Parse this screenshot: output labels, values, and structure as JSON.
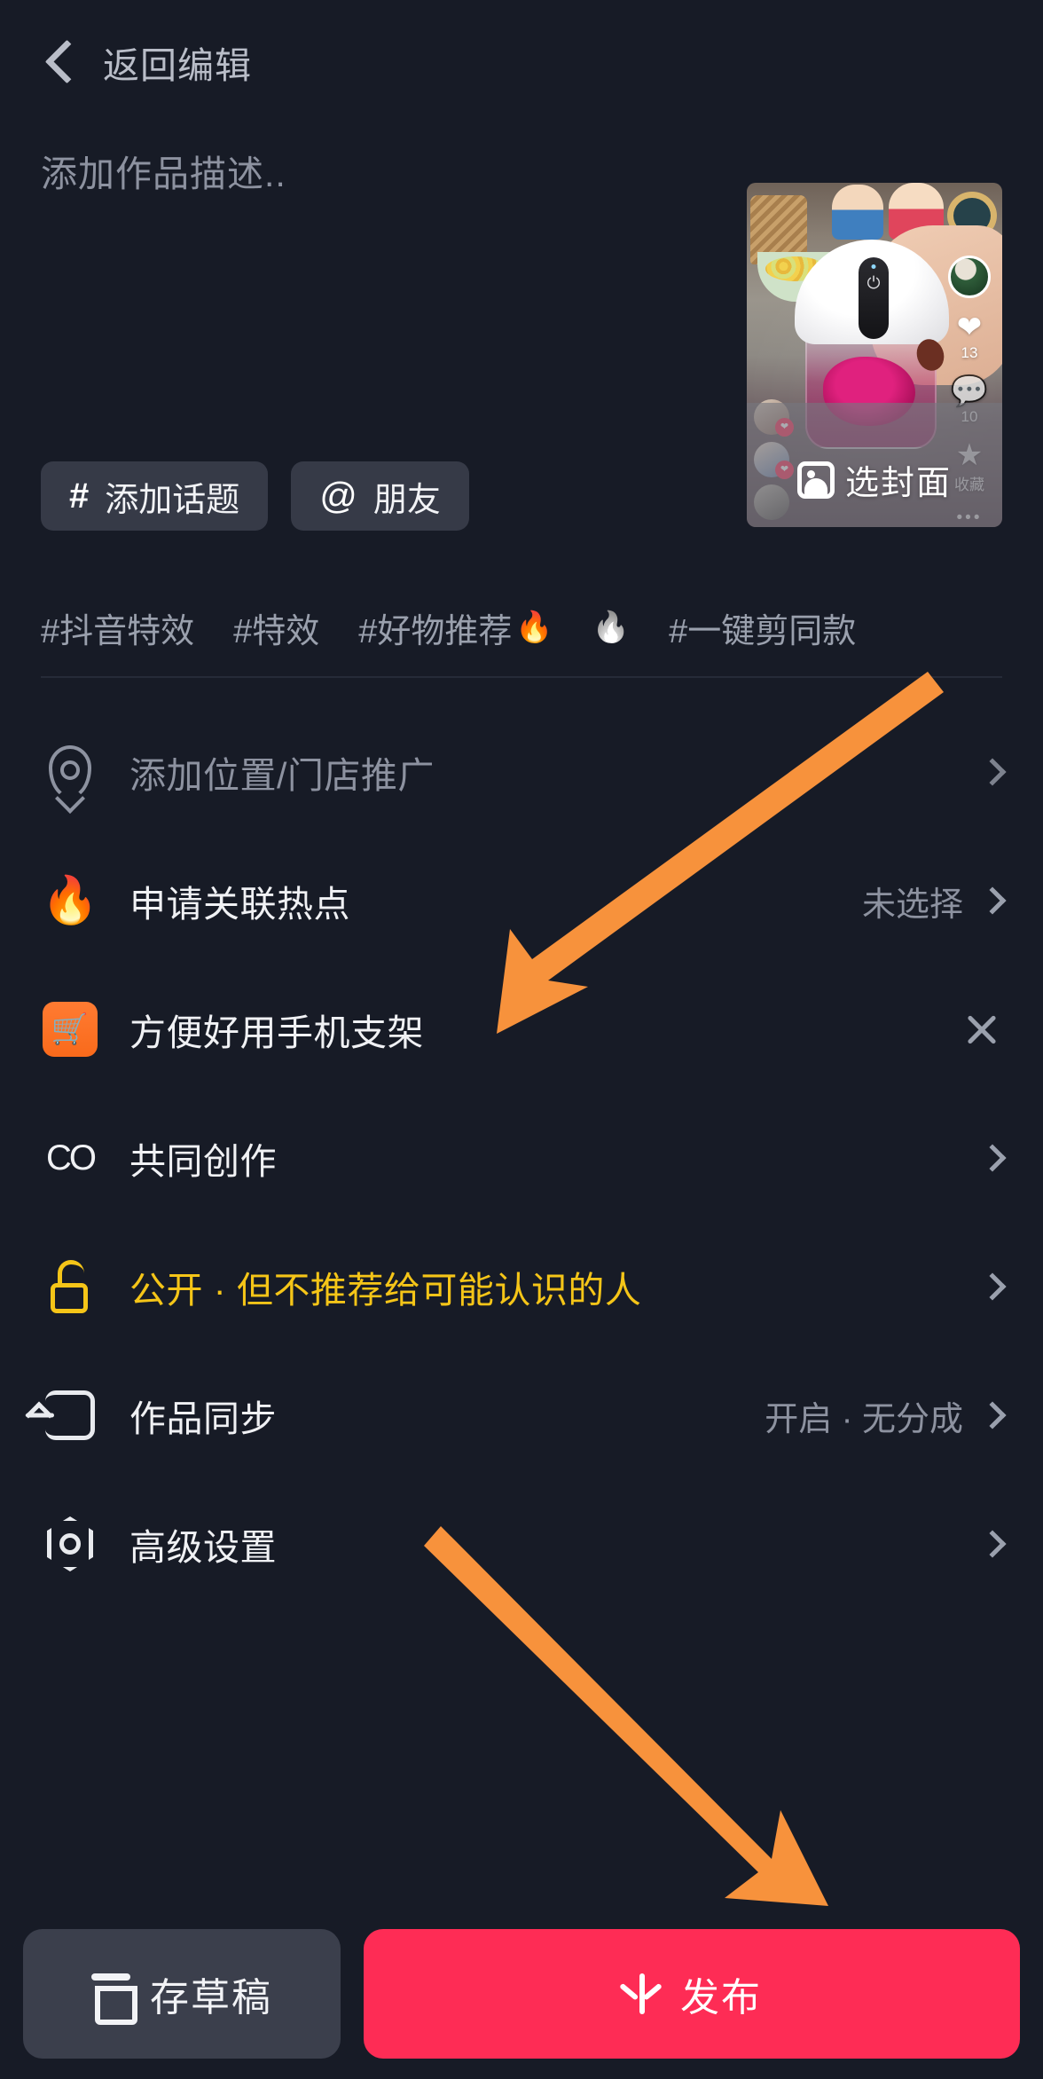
{
  "header": {
    "back_label": "返回编辑",
    "back_icon": "chevron-left-icon"
  },
  "description": {
    "placeholder": "添加作品描述..",
    "value": ""
  },
  "chips": [
    {
      "glyph": "#",
      "label": "添加话题",
      "name": "add-topic"
    },
    {
      "glyph": "@",
      "label": "朋友",
      "name": "mention-friend"
    }
  ],
  "hashtag_suggestions": [
    {
      "text": "#抖音特效",
      "emoji": ""
    },
    {
      "text": "#特效",
      "emoji": ""
    },
    {
      "text": "#好物推荐",
      "emoji": "🔥"
    },
    {
      "text": "",
      "emoji": "🔥",
      "gray": true
    },
    {
      "text": "#一键剪同款",
      "emoji": ""
    }
  ],
  "rows": {
    "location": {
      "icon": "location-pin-icon",
      "label": "添加位置/门店推广",
      "value": "",
      "chevron": "chevron-right-icon"
    },
    "hotspot": {
      "icon": "flame-icon",
      "icon_glyph": "🔥",
      "label": "申请关联热点",
      "value": "未选择",
      "chevron": "chevron-right-icon"
    },
    "product": {
      "icon": "shopping-cart-icon",
      "icon_glyph": "🛒",
      "label": "方便好用手机支架",
      "action": "close-icon"
    },
    "cocreate": {
      "icon": "co-create-icon",
      "icon_glyph": "CO",
      "label": "共同创作",
      "value": "",
      "chevron": "chevron-right-icon"
    },
    "privacy": {
      "icon": "unlock-icon",
      "label": "公开 · 但不推荐给可能认识的人",
      "value": "",
      "chevron": "chevron-right-icon",
      "color": "#f5c518"
    },
    "sync": {
      "icon": "sync-export-icon",
      "label": "作品同步",
      "value": "开启 · 无分成",
      "chevron": "chevron-right-icon"
    },
    "advanced": {
      "icon": "advanced-settings-icon",
      "label": "高级设置",
      "value": "",
      "chevron": "chevron-right-icon"
    }
  },
  "thumbnail": {
    "cover_cta": "选封面",
    "cover_icon": "image-icon",
    "rail": {
      "avatar": "author-avatar",
      "like_icon": "heart-icon",
      "like_count": "13",
      "comment_icon": "comment-bubble-icon",
      "comment_count": "10",
      "favorite_icon": "star-icon",
      "favorite_label": "收藏",
      "more_icon": "more-dots-icon",
      "more_glyph": "•••"
    }
  },
  "bottom": {
    "draft_label": "存草稿",
    "draft_icon": "draft-box-icon",
    "publish_label": "发布",
    "publish_icon": "publish-star-icon"
  },
  "colors": {
    "background": "#171b26",
    "accent_pink": "#fe2c55",
    "accent_orange": "#f7923c",
    "accent_yellow": "#f5c518",
    "chip_bg": "#363a47",
    "muted_text": "#8d92a0"
  },
  "annotations": [
    {
      "name": "arrow-to-product-row",
      "color": "#f7923c"
    },
    {
      "name": "arrow-to-publish-button",
      "color": "#f7923c"
    }
  ]
}
